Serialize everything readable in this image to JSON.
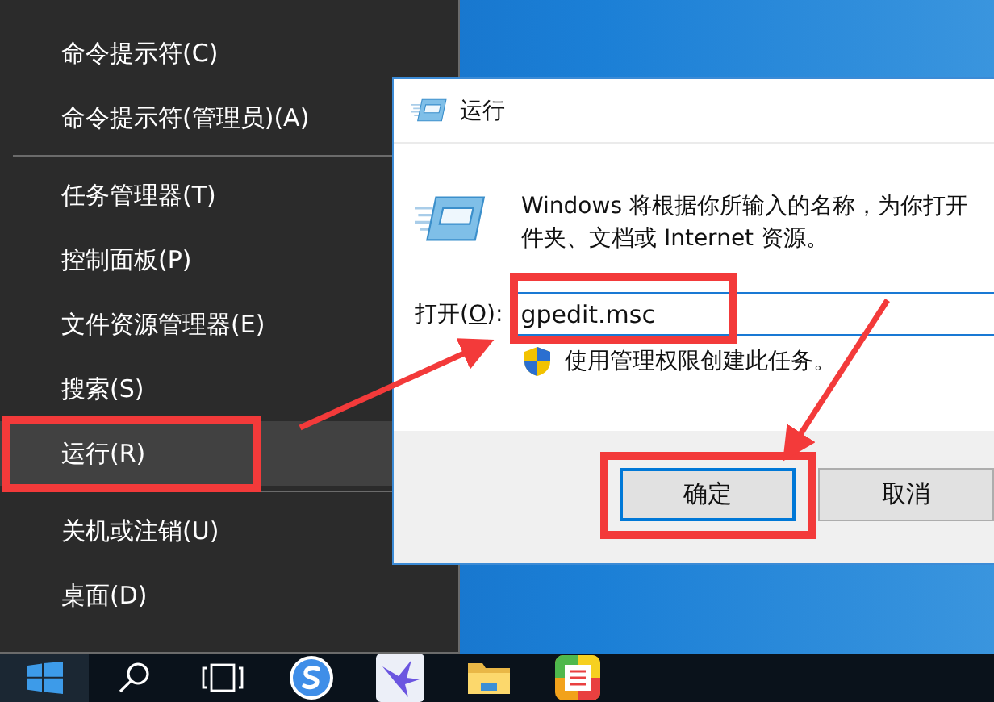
{
  "start_menu": {
    "groups": [
      [
        {
          "label": "命令提示符(C)",
          "selected": false
        },
        {
          "label": "命令提示符(管理员)(A)",
          "selected": false
        }
      ],
      [
        {
          "label": "任务管理器(T)",
          "selected": false
        },
        {
          "label": "控制面板(P)",
          "selected": false
        },
        {
          "label": "文件资源管理器(E)",
          "selected": false
        },
        {
          "label": "搜索(S)",
          "selected": false
        },
        {
          "label": "运行(R)",
          "selected": true
        }
      ],
      [
        {
          "label": "关机或注销(U)",
          "selected": false
        },
        {
          "label": "桌面(D)",
          "selected": false
        }
      ]
    ]
  },
  "run_dialog": {
    "title": "运行",
    "description": [
      "Windows 将根据你所输入的名称，为你打开",
      "件夹、文档或 Internet 资源。"
    ],
    "open_label": [
      "打开(",
      "O",
      "):"
    ],
    "command": "gpedit.msc",
    "admin_note": "使用管理权限创建此任务。",
    "buttons": [
      {
        "label": "确定",
        "default": true
      },
      {
        "label": "取消",
        "default": false
      }
    ]
  }
}
